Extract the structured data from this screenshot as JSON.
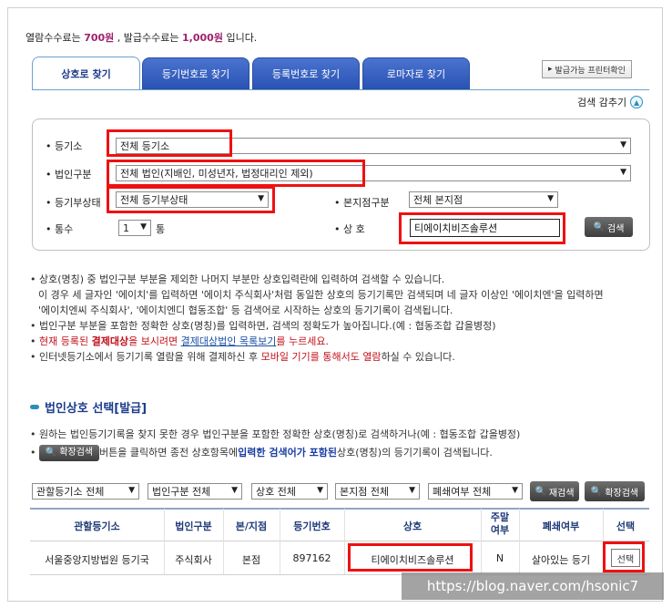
{
  "fee": {
    "prefix": "열람수수료는 ",
    "view_fee": "700원",
    "middle": " , 발급수수료는 ",
    "issue_fee": "1,000원",
    "suffix": " 입니다."
  },
  "tabs": [
    "상호로 찾기",
    "등기번호로 찾기",
    "등록번호로 찾기",
    "로마자로 찾기"
  ],
  "print_button": "발급가능 프린터확인",
  "collapse_label": "검색 감추기",
  "form": {
    "registry_label": "등기소",
    "registry_value": "전체 등기소",
    "corp_type_label": "법인구분",
    "corp_type_value": "전체 법인(지배인, 미성년자, 법정대리인 제외)",
    "status_label": "등기부상태",
    "status_value": "전체 등기부상태",
    "branch_label": "본지점구분",
    "branch_value": "전체 본지점",
    "count_label": "통수",
    "count_value": "1",
    "count_unit": "통",
    "name_label": "상 호",
    "name_value": "티에이치비즈솔루션",
    "search_button": "검색"
  },
  "notes": {
    "n1": "상호(명칭) 중 법인구분 부분을 제외한 나머지 부분만 상호입력란에 입력하여 검색할 수 있습니다.",
    "n1b": "이 경우 세 글자인 '에이치'를 입력하면 '에이치 주식회사'처럼 동일한 상호의 등기기록만 검색되며 네 글자 이상인 '에이치엔'을 입력하면",
    "n1c": "'에이치엔씨 주식회사', '에이치엔디 협동조합' 등 검색어로 시작하는 상호의 등기기록이 검색됩니다.",
    "n2": "법인구분 부분을 포함한 정확한 상호(명칭)를 입력하면, 검색의 정확도가 높아집니다.(예 : 협동조합 갑을병정)",
    "n3a": "현재 등록된 ",
    "n3b": "결제대상",
    "n3c": "을 보시려면 ",
    "n3d": "결제대상법인 목록보기",
    "n3e": "를 누르세요.",
    "n4a": "인터넷등기소에서 등기기록 열람을 위해 결제하신 후 ",
    "n4b": "모바일 기기를 통해서도 열람",
    "n4c": "하실 수 있습니다."
  },
  "section": {
    "title": "법인상호 선택[발급]",
    "tip1": "원하는 법인등기기록을 찾지 못한 경우 법인구분을 포함한 정확한 상호(명칭)로 검색하거나(예 : 협동조합 갑을병정)",
    "tip2_button": "확장검색",
    "tip2a": " 버튼을 클릭하면 종전 상호항목에 ",
    "tip2b": "입력한 검색어가 포함된",
    "tip2c": " 상호(명칭)의 등기기록이 검색됩니다."
  },
  "filters": [
    "관할등기소 전체",
    "법인구분 전체",
    "상호 전체",
    "본지점 전체",
    "폐쇄여부 전체"
  ],
  "filter_buttons": [
    "재검색",
    "확장검색"
  ],
  "table": {
    "headers": [
      "관할등기소",
      "법인구분",
      "본/지점",
      "등기번호",
      "상호",
      "주말\n여부",
      "폐쇄여부",
      "선택"
    ],
    "row": [
      "서울중앙지방법원 등기국",
      "주식회사",
      "본점",
      "897162",
      "티에이치비즈솔루션",
      "N",
      "살아있는 등기",
      "선택"
    ]
  },
  "watermark": "https://blog.naver.com/hsonic7"
}
